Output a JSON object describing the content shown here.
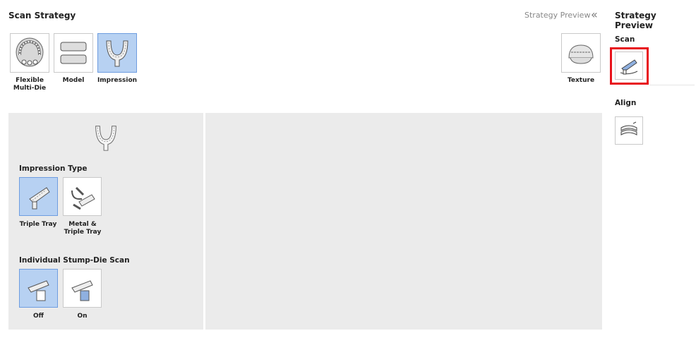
{
  "header": {
    "title": "Scan Strategy",
    "preview_link": "Strategy Preview",
    "collapse_glyph": "«"
  },
  "strategies": [
    {
      "label": "Flexible\nMulti-Die",
      "icon": "full-arch-icon",
      "selected": false
    },
    {
      "label": "Model",
      "icon": "model-icon",
      "selected": false
    },
    {
      "label": "Impression",
      "icon": "impression-tray-icon",
      "selected": true
    }
  ],
  "texture": {
    "label": "Texture",
    "icon": "texture-icon"
  },
  "impression_type": {
    "title": "Impression Type",
    "options": [
      {
        "label": "Triple Tray",
        "selected": true
      },
      {
        "label": "Metal &\nTriple Tray",
        "selected": false
      }
    ]
  },
  "stump_die": {
    "title": "Individual Stump-Die Scan",
    "options": [
      {
        "label": "Off",
        "selected": true
      },
      {
        "label": "On",
        "selected": false
      }
    ]
  },
  "sidebar": {
    "title": "Strategy Preview",
    "scan_heading": "Scan",
    "align_heading": "Align"
  },
  "colors": {
    "selected_fill": "#b7d1f2",
    "selected_border": "#6e9de0",
    "panel_bg": "#ebebeb",
    "highlight": "#e8121b"
  }
}
